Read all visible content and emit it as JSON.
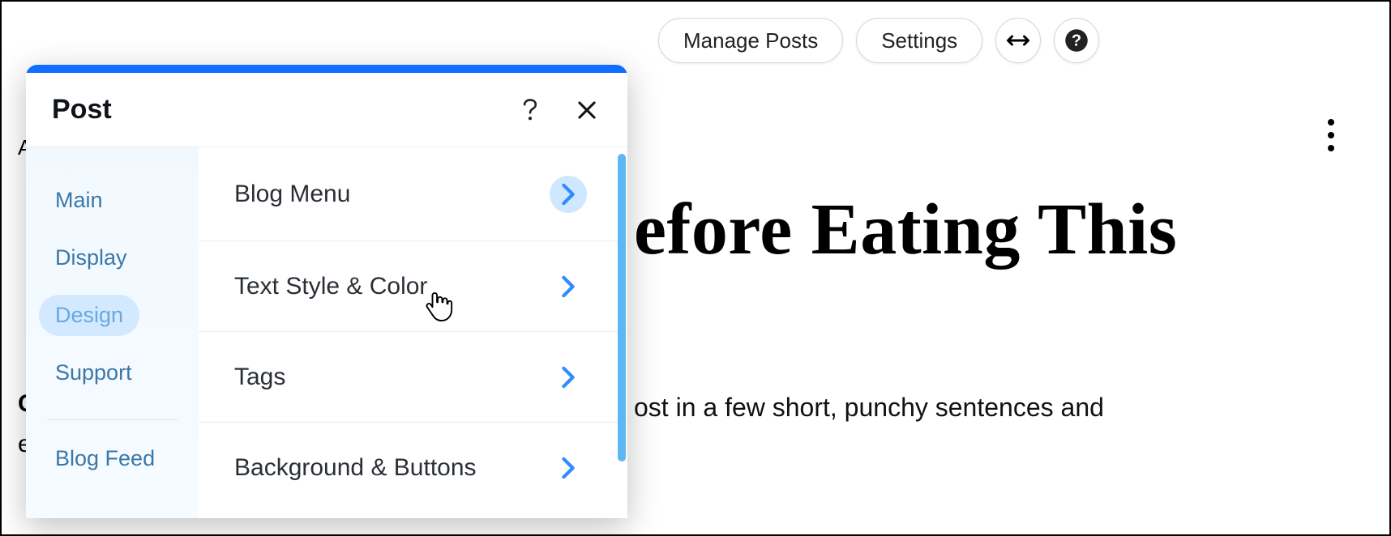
{
  "topbar": {
    "managePosts": "Manage Posts",
    "settings": "Settings"
  },
  "article": {
    "titleVisible": "efore Eating This",
    "snippetVisible": "ost in a few short, punchy sentences and"
  },
  "peekChars": {
    "a": "A",
    "c": "C",
    "e": "e"
  },
  "panel": {
    "title": "Post",
    "sidebar": {
      "items": [
        {
          "label": "Main"
        },
        {
          "label": "Display"
        },
        {
          "label": "Design"
        },
        {
          "label": "Support"
        }
      ],
      "activeIndex": 2,
      "footer": "Blog Feed"
    },
    "options": [
      {
        "label": "Blog Menu",
        "highlight": true
      },
      {
        "label": "Text Style & Color"
      },
      {
        "label": "Tags"
      },
      {
        "label": "Background & Buttons"
      }
    ]
  }
}
